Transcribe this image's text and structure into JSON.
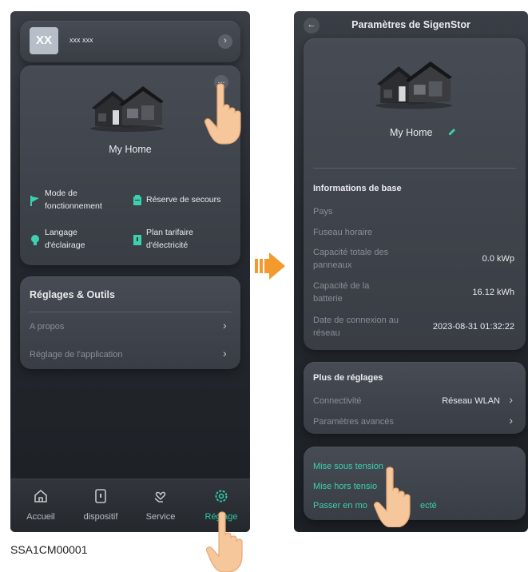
{
  "left_screen": {
    "user": {
      "initials": "XX",
      "name": "xxx xxx"
    },
    "home_name": "My Home",
    "more_button_label": "...",
    "features": [
      {
        "label": "Mode de fonctionnement",
        "icon": "flag-icon"
      },
      {
        "label": "Réserve de secours",
        "icon": "battery-icon"
      },
      {
        "label": "Langage d'éclairage",
        "icon": "bulb-icon"
      },
      {
        "label": "Plan tarifaire d'électricité",
        "icon": "bookmark-icon"
      }
    ],
    "feature_lines": {
      "mode_1": "Mode de",
      "mode_2": "fonctionnement",
      "reserve": "Réserve de secours",
      "lang_1": "Langage",
      "lang_2": "d'éclairage",
      "plan_1": "Plan tarifaire",
      "plan_2": "d'électricité"
    },
    "tools": {
      "title": "Réglages & Outils",
      "items": [
        "A propos",
        "Réglage de l'application"
      ]
    },
    "nav": [
      {
        "label": "Accueil",
        "icon": "home-icon",
        "active": false
      },
      {
        "label": "dispositif",
        "icon": "device-icon",
        "active": false
      },
      {
        "label": "Service",
        "icon": "heart-hands-icon",
        "active": false
      },
      {
        "label": "Réglage",
        "icon": "gear-icon",
        "active": true
      }
    ]
  },
  "right_screen": {
    "title": "Paramètres de SigenStor",
    "home_name": "My Home",
    "basic_info": {
      "title": "Informations de base",
      "pays_label": "Pays",
      "fuseau_label": "Fuseau horaire",
      "capacite_panneaux_label_1": "Capacité totale des",
      "capacite_panneaux_label_2": "panneaux",
      "capacite_panneaux_value": "0.0 kWp",
      "capacite_batterie_label_1": "Capacité de la",
      "capacite_batterie_label_2": "batterie",
      "capacite_batterie_value": "16.12 kWh",
      "connexion_label_1": "Date de connexion au",
      "connexion_label_2": "réseau",
      "connexion_value": "2023-08-31 01:32:22"
    },
    "more_settings": {
      "title": "Plus de réglages",
      "connectivite_label": "Connectivité",
      "connectivite_value": "Réseau WLAN",
      "avances_label": "Paramètres avancés"
    },
    "power": {
      "on": "Mise sous tension",
      "off": "Mise hors tensio",
      "offline": "Passer en mo",
      "offline_tail": "ecté"
    }
  },
  "caption": "SSA1CM00001",
  "colors": {
    "accent": "#3bd1b0",
    "hand": "#f6c79a",
    "arrow": "#f29a2e"
  }
}
